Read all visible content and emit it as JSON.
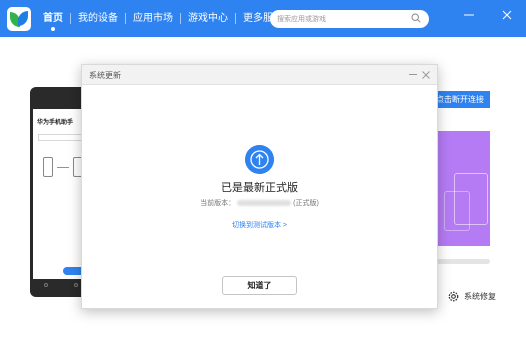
{
  "topbar": {
    "nav": [
      {
        "label": "首页",
        "active": true
      },
      {
        "label": "我的设备",
        "active": false
      },
      {
        "label": "应用市场",
        "active": false
      },
      {
        "label": "游戏中心",
        "active": false
      },
      {
        "label": "更多服务",
        "active": false
      }
    ],
    "search_placeholder": "搜索应用或游戏"
  },
  "background": {
    "connect_button": "点击断开连接",
    "repair_label": "系统修复",
    "phone_title": "华为手机助手"
  },
  "dialog": {
    "title": "系统更新",
    "heading": "已是最新正式版",
    "version_prefix": "当前版本：",
    "version_suffix": "(正式版)",
    "switch_link": "切换到测试版本 >",
    "ok_button": "知道了"
  },
  "colors": {
    "accent": "#2f83f0",
    "purple": "#b57bf4"
  },
  "icons": [
    "app-logo-icon",
    "search-icon",
    "minimize-icon",
    "close-icon",
    "upload-arrow-icon",
    "gear-icon"
  ]
}
